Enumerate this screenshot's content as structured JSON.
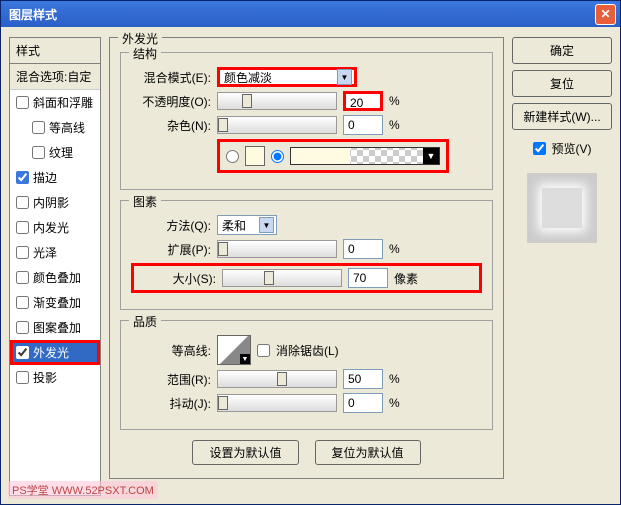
{
  "title": "图层样式",
  "styles": {
    "header": "样式",
    "sub": "混合选项:自定",
    "items": [
      {
        "label": "斜面和浮雕",
        "checked": false,
        "indent": false
      },
      {
        "label": "等高线",
        "checked": false,
        "indent": true
      },
      {
        "label": "纹理",
        "checked": false,
        "indent": true
      },
      {
        "label": "描边",
        "checked": true,
        "indent": false
      },
      {
        "label": "内阴影",
        "checked": false,
        "indent": false
      },
      {
        "label": "内发光",
        "checked": false,
        "indent": false
      },
      {
        "label": "光泽",
        "checked": false,
        "indent": false
      },
      {
        "label": "颜色叠加",
        "checked": false,
        "indent": false
      },
      {
        "label": "渐变叠加",
        "checked": false,
        "indent": false
      },
      {
        "label": "图案叠加",
        "checked": false,
        "indent": false
      },
      {
        "label": "外发光",
        "checked": true,
        "indent": false,
        "selected": true
      },
      {
        "label": "投影",
        "checked": false,
        "indent": false
      }
    ]
  },
  "panel": {
    "title": "外发光",
    "structure": {
      "legend": "结构",
      "blend_label": "混合模式(E):",
      "blend_value": "颜色减淡",
      "opacity_label": "不透明度(O):",
      "opacity_value": "20",
      "opacity_unit": "%",
      "noise_label": "杂色(N):",
      "noise_value": "0",
      "noise_unit": "%"
    },
    "elements": {
      "legend": "图素",
      "method_label": "方法(Q):",
      "method_value": "柔和",
      "spread_label": "扩展(P):",
      "spread_value": "0",
      "spread_unit": "%",
      "size_label": "大小(S):",
      "size_value": "70",
      "size_unit": "像素"
    },
    "quality": {
      "legend": "品质",
      "contour_label": "等高线:",
      "antialias_label": "消除锯齿(L)",
      "range_label": "范围(R):",
      "range_value": "50",
      "range_unit": "%",
      "jitter_label": "抖动(J):",
      "jitter_value": "0",
      "jitter_unit": "%"
    },
    "buttons": {
      "default": "设置为默认值",
      "reset": "复位为默认值"
    }
  },
  "right": {
    "ok": "确定",
    "cancel": "复位",
    "newstyle": "新建样式(W)...",
    "preview_label": "预览(V)"
  },
  "watermark": "PS学堂  WWW.52PSXT.COM"
}
